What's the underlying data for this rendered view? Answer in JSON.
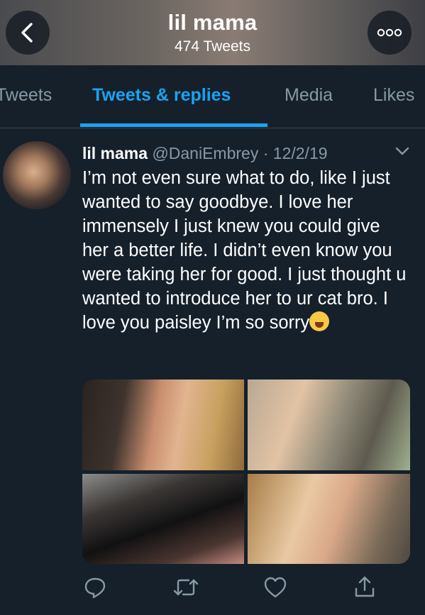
{
  "header": {
    "title": "lil mama",
    "tweet_count": "474 Tweets",
    "back_icon": "chevron-left-icon",
    "more_icon": "more-horizontal-icon"
  },
  "tabs": [
    {
      "label": "Tweets",
      "active": false
    },
    {
      "label": "Tweets & replies",
      "active": true
    },
    {
      "label": "Media",
      "active": false
    },
    {
      "label": "Likes",
      "active": false
    }
  ],
  "tweet": {
    "display_name": "lil mama",
    "handle": "@DaniEmbrey",
    "separator": "·",
    "date": "12/2/19",
    "text": "I’m not even sure what to do, like I just wanted to say goodbye. I love her immensely I just knew you could give her a better life. I didn’t even know you were taking her for good. I just thought u wanted to introduce her to ur cat bro. I love you paisley I’m so sorry",
    "emoji": "loudly-crying-face",
    "photo_count": 4,
    "actions": [
      "reply-icon",
      "retweet-icon",
      "like-icon",
      "share-icon"
    ]
  },
  "colors": {
    "background": "#15202b",
    "accent": "#1da1f2",
    "secondary_text": "#8899a6",
    "divider": "#38444d"
  }
}
